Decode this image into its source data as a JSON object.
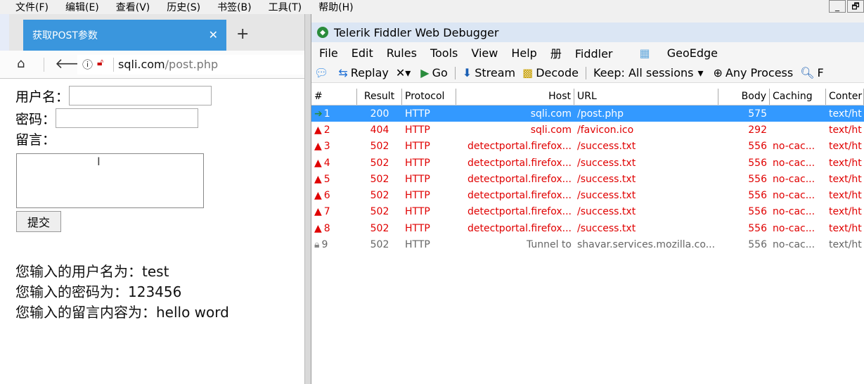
{
  "firefox": {
    "menubar": [
      "文件(F)",
      "编辑(E)",
      "查看(V)",
      "历史(S)",
      "书签(B)",
      "工具(T)",
      "帮助(H)"
    ],
    "tab_title": "获取POST参数",
    "url_host": "sqli.com",
    "url_path": "/post.php",
    "form": {
      "username_label": "用户名：",
      "password_label": "密码：",
      "message_label": "留言：",
      "submit_label": "提交"
    },
    "results": [
      "您输入的用户名为：test",
      "您输入的密码为：123456",
      "您输入的留言内容为：hello word"
    ]
  },
  "window_controls": [
    "_",
    "🗗"
  ],
  "fiddler": {
    "title": "Telerik Fiddler Web Debugger",
    "menu": [
      "File",
      "Edit",
      "Rules",
      "Tools",
      "View",
      "Help",
      "Fiddler",
      "GeoEdge"
    ],
    "toolbar": {
      "replay": "Replay",
      "go": "Go",
      "stream": "Stream",
      "decode": "Decode",
      "keep": "Keep: All sessions",
      "process": "Any Process",
      "find": "F"
    },
    "columns": [
      "#",
      "Result",
      "Protocol",
      "Host",
      "URL",
      "Body",
      "Caching",
      "Conter"
    ],
    "sessions": [
      {
        "num": "1",
        "result": "200",
        "protocol": "HTTP",
        "host": "sqli.com",
        "url": "/post.php",
        "body": "575",
        "caching": "",
        "ctype": "text/ht",
        "status": "selected"
      },
      {
        "num": "2",
        "result": "404",
        "protocol": "HTTP",
        "host": "sqli.com",
        "url": "/favicon.ico",
        "body": "292",
        "caching": "",
        "ctype": "text/ht",
        "status": "error"
      },
      {
        "num": "3",
        "result": "502",
        "protocol": "HTTP",
        "host": "detectportal.firefox...",
        "url": "/success.txt",
        "body": "556",
        "caching": "no-cac...",
        "ctype": "text/ht",
        "status": "error"
      },
      {
        "num": "4",
        "result": "502",
        "protocol": "HTTP",
        "host": "detectportal.firefox...",
        "url": "/success.txt",
        "body": "556",
        "caching": "no-cac...",
        "ctype": "text/ht",
        "status": "error"
      },
      {
        "num": "5",
        "result": "502",
        "protocol": "HTTP",
        "host": "detectportal.firefox...",
        "url": "/success.txt",
        "body": "556",
        "caching": "no-cac...",
        "ctype": "text/ht",
        "status": "error"
      },
      {
        "num": "6",
        "result": "502",
        "protocol": "HTTP",
        "host": "detectportal.firefox...",
        "url": "/success.txt",
        "body": "556",
        "caching": "no-cac...",
        "ctype": "text/ht",
        "status": "error"
      },
      {
        "num": "7",
        "result": "502",
        "protocol": "HTTP",
        "host": "detectportal.firefox...",
        "url": "/success.txt",
        "body": "556",
        "caching": "no-cac...",
        "ctype": "text/ht",
        "status": "error"
      },
      {
        "num": "8",
        "result": "502",
        "protocol": "HTTP",
        "host": "detectportal.firefox...",
        "url": "/success.txt",
        "body": "556",
        "caching": "no-cac...",
        "ctype": "text/ht",
        "status": "error"
      },
      {
        "num": "9",
        "result": "502",
        "protocol": "HTTP",
        "host": "Tunnel to",
        "url": "shavar.services.mozilla.co...",
        "body": "556",
        "caching": "no-cac...",
        "ctype": "text/ht",
        "status": "tunnel"
      }
    ]
  },
  "colors": {
    "tab_active": "#3a96dd",
    "selection": "#3399ff",
    "error": "#e00000"
  }
}
